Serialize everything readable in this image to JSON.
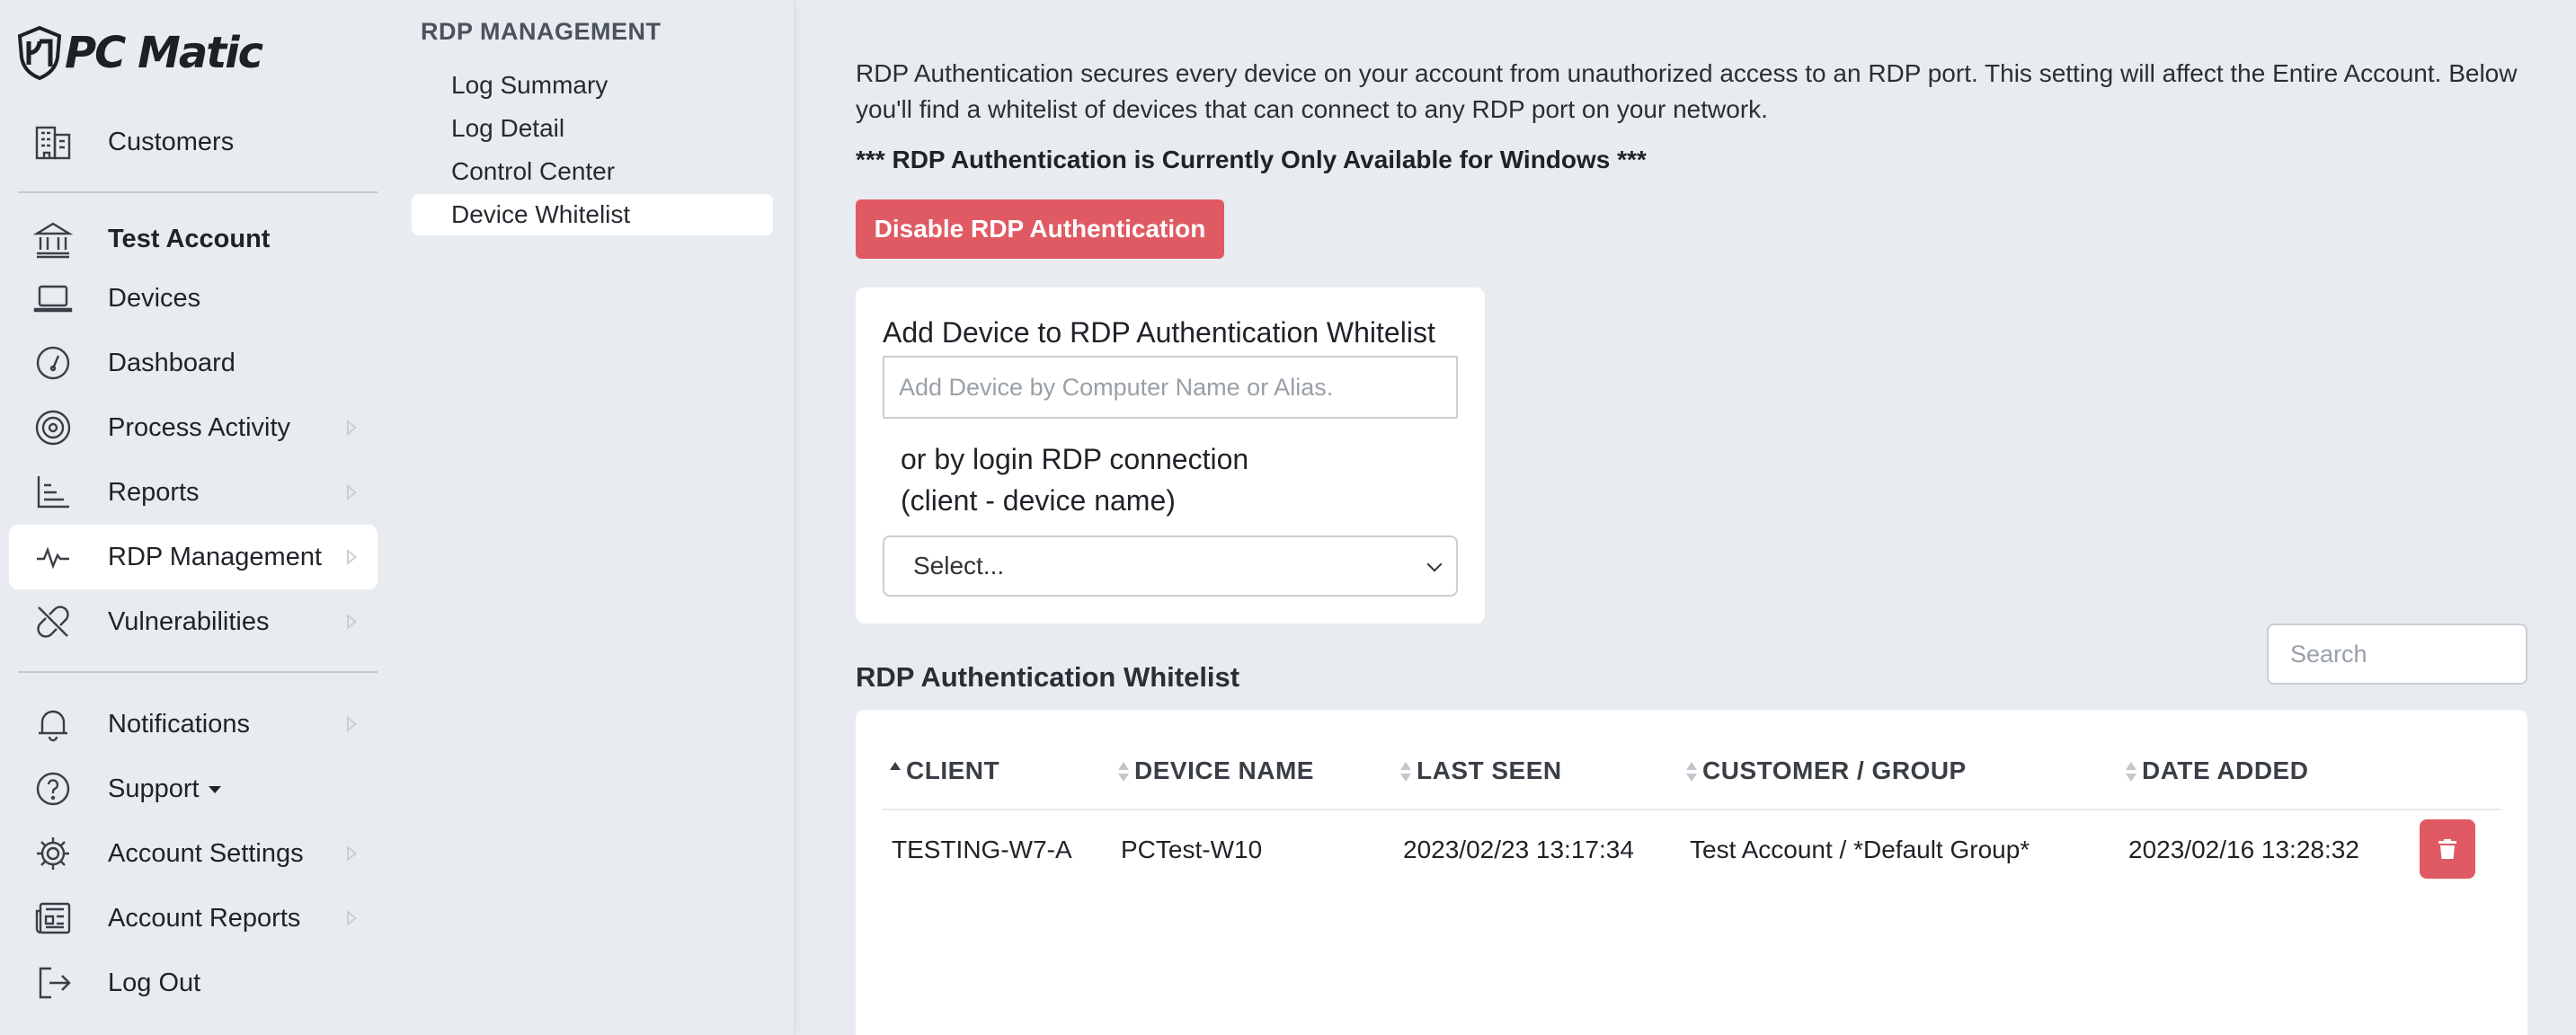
{
  "app": {
    "logo_text": "PC Matic"
  },
  "sidebar": {
    "items": [
      {
        "label": "Customers",
        "icon": "building-icon"
      },
      {
        "label": "Test Account",
        "icon": "bank-icon"
      },
      {
        "label": "Devices",
        "icon": "laptop-icon"
      },
      {
        "label": "Dashboard",
        "icon": "gauge-icon"
      },
      {
        "label": "Process Activity",
        "icon": "target-icon"
      },
      {
        "label": "Reports",
        "icon": "bar-chart-icon"
      },
      {
        "label": "RDP Management",
        "icon": "pulse-icon"
      },
      {
        "label": "Vulnerabilities",
        "icon": "broken-link-icon"
      },
      {
        "label": "Notifications",
        "icon": "bell-icon"
      },
      {
        "label": "Support",
        "icon": "question-icon"
      },
      {
        "label": "Account Settings",
        "icon": "gear-icon"
      },
      {
        "label": "Account Reports",
        "icon": "newspaper-icon"
      },
      {
        "label": "Log Out",
        "icon": "logout-icon"
      }
    ]
  },
  "subnav": {
    "title": "RDP MANAGEMENT",
    "items": [
      {
        "label": "Log Summary"
      },
      {
        "label": "Log Detail"
      },
      {
        "label": "Control Center"
      },
      {
        "label": "Device Whitelist"
      }
    ]
  },
  "main": {
    "intro": "RDP Authentication secures every device on your account from unauthorized access to an RDP port. This setting will affect the Entire Account. Below you'll find a whitelist of devices that can connect to any RDP port on your network.",
    "notice": "*** RDP Authentication is Currently Only Available for Windows ***",
    "disable_button": "Disable RDP Authentication",
    "add_card": {
      "title": "Add Device to RDP Authentication Whitelist",
      "input_placeholder": "Add Device by Computer Name or Alias.",
      "or_line1": "or by login RDP connection",
      "or_line2": "(client - device name)",
      "select_value": "Select..."
    },
    "search_placeholder": "Search",
    "whitelist_title": "RDP Authentication Whitelist",
    "table": {
      "columns": [
        "CLIENT",
        "DEVICE NAME",
        "LAST SEEN",
        "CUSTOMER / GROUP",
        "DATE ADDED"
      ],
      "sorted_column": "CLIENT",
      "sort_direction": "ascending",
      "rows": [
        [
          "TESTING-W7-A",
          "PCTest-W10",
          "2023/02/23 13:17:34",
          "Test Account / *Default Group*",
          "2023/02/16 13:28:32"
        ]
      ]
    }
  },
  "colors": {
    "background": "#e8ecf1",
    "danger": "#e05a63",
    "card": "#ffffff"
  }
}
